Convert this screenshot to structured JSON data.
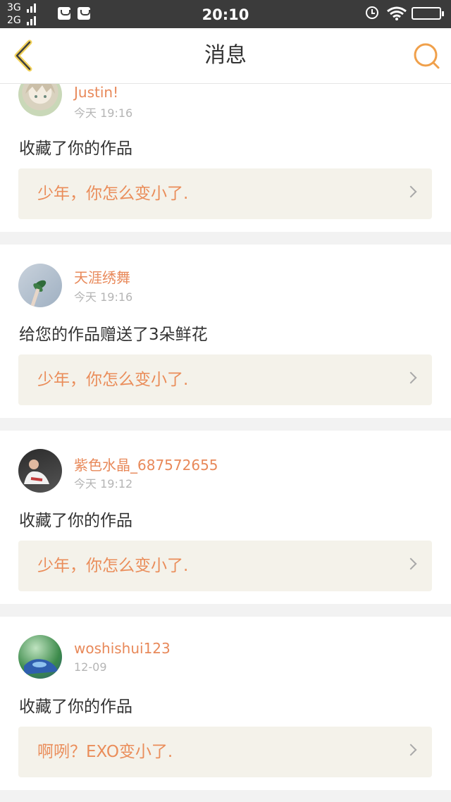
{
  "status_bar": {
    "network_1": "3G",
    "network_2": "2G",
    "time": "20:10",
    "icons": [
      "signal-icon",
      "mail-notification-icon",
      "alarm-icon",
      "wifi-icon",
      "battery-icon"
    ]
  },
  "header": {
    "title": "消息",
    "accent_color": "#f0a04b"
  },
  "messages": [
    {
      "user": "Justin!",
      "time": "今天 19:16",
      "action": "收藏了你的作品",
      "work_title": "少年，你怎么变小了."
    },
    {
      "user": "天涯绣舞",
      "time": "今天 19:16",
      "action": "给您的作品赠送了3朵鲜花",
      "work_title": "少年，你怎么变小了."
    },
    {
      "user": "紫色水晶_687572655",
      "time": "今天 19:12",
      "action": "收藏了你的作品",
      "work_title": "少年，你怎么变小了."
    },
    {
      "user": "woshishui123",
      "time": "12-09",
      "action": "收藏了你的作品",
      "work_title": "啊咧？EXO变小了."
    }
  ]
}
